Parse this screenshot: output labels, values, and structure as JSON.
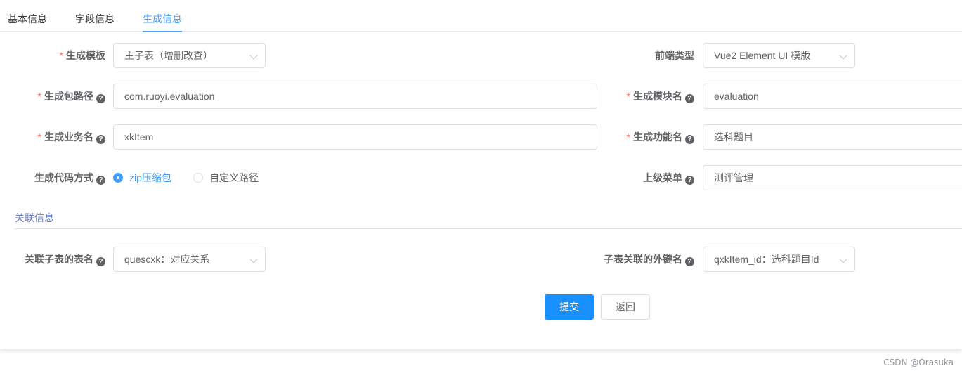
{
  "tabs": [
    {
      "label": "基本信息"
    },
    {
      "label": "字段信息"
    },
    {
      "label": "生成信息"
    }
  ],
  "form": {
    "template": {
      "label": "生成模板",
      "value": "主子表（增删改查）"
    },
    "frontend_type": {
      "label": "前端类型",
      "value": "Vue2 Element UI 模版"
    },
    "package_path": {
      "label": "生成包路径",
      "value": "com.ruoyi.evaluation"
    },
    "module_name": {
      "label": "生成模块名",
      "value": "evaluation"
    },
    "business_name": {
      "label": "生成业务名",
      "value": "xkItem"
    },
    "function_name": {
      "label": "生成功能名",
      "value": "选科题目"
    },
    "gen_type": {
      "label": "生成代码方式",
      "options": [
        "zip压缩包",
        "自定义路径"
      ],
      "selected": "zip压缩包"
    },
    "parent_menu": {
      "label": "上级菜单",
      "value": "测评管理"
    }
  },
  "related": {
    "section_title": "关联信息",
    "sub_table": {
      "label": "关联子表的表名",
      "value": "quescxk：对应关系"
    },
    "fk_name": {
      "label": "子表关联的外键名",
      "value": "qxkItem_id：选科题目Id"
    }
  },
  "buttons": {
    "submit": "提交",
    "back": "返回"
  },
  "watermark": "CSDN @Orasuka",
  "colors": {
    "primary": "#1890ff",
    "active_tab": "#409eff",
    "required": "#f56c6c",
    "section": "#6379bb"
  }
}
